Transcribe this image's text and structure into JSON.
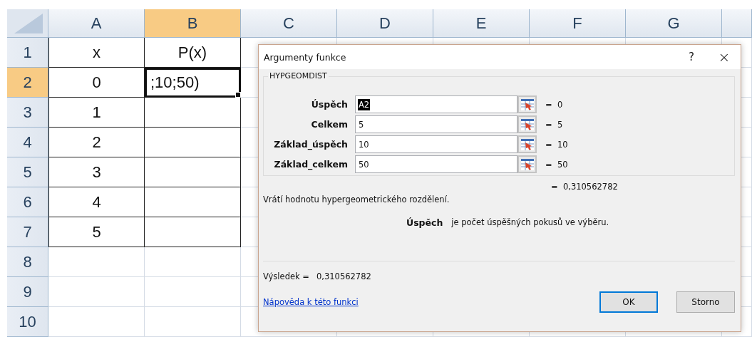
{
  "sheet": {
    "columns": [
      {
        "label": "A",
        "selected": false
      },
      {
        "label": "B",
        "selected": true
      },
      {
        "label": "C",
        "selected": false
      },
      {
        "label": "D",
        "selected": false
      },
      {
        "label": "E",
        "selected": false
      },
      {
        "label": "F",
        "selected": false
      },
      {
        "label": "G",
        "selected": false
      }
    ],
    "rows": [
      {
        "header": "1",
        "selected": false,
        "boxed": true,
        "cells": [
          {
            "text": "x",
            "active": false
          },
          {
            "text": "P(x)",
            "active": false
          }
        ]
      },
      {
        "header": "2",
        "selected": true,
        "boxed": true,
        "cells": [
          {
            "text": "0",
            "active": false
          },
          {
            "text": ";10;50)",
            "active": true
          }
        ]
      },
      {
        "header": "3",
        "selected": false,
        "boxed": true,
        "cells": [
          {
            "text": "1",
            "active": false
          }
        ]
      },
      {
        "header": "4",
        "selected": false,
        "boxed": true,
        "cells": [
          {
            "text": "2",
            "active": false
          }
        ]
      },
      {
        "header": "5",
        "selected": false,
        "boxed": true,
        "cells": [
          {
            "text": "3",
            "active": false
          }
        ]
      },
      {
        "header": "6",
        "selected": false,
        "boxed": true,
        "cells": [
          {
            "text": "4",
            "active": false
          }
        ]
      },
      {
        "header": "7",
        "selected": false,
        "boxed": true,
        "cells": [
          {
            "text": "5",
            "active": false
          }
        ]
      },
      {
        "header": "8",
        "selected": false,
        "boxed": false
      },
      {
        "header": "9",
        "selected": false,
        "boxed": false
      },
      {
        "header": "10",
        "selected": false,
        "boxed": false
      }
    ]
  },
  "dialog": {
    "title": "Argumenty funkce",
    "help_button": "?",
    "close_button": "×",
    "function_name": "HYPGEOMDIST",
    "arguments": [
      {
        "label": "Úspěch",
        "value": "A2",
        "highlighted": true,
        "result": "=  0"
      },
      {
        "label": "Celkem",
        "value": "5",
        "highlighted": false,
        "result": "=  5"
      },
      {
        "label": "Základ_úspěch",
        "value": "10",
        "highlighted": false,
        "result": "=  10"
      },
      {
        "label": "Základ_celkem",
        "value": "50",
        "highlighted": false,
        "result": "=  50"
      }
    ],
    "formula_result": "=  0,310562782",
    "description": "Vrátí hodnotu hypergeometrického rozdělení.",
    "arg_name": "Úspěch",
    "arg_help": "je počet úspěšných pokusů ve výběru.",
    "result_label": "Výsledek =",
    "result_value": "0,310562782",
    "help_link": "Nápověda k této funkci",
    "buttons": [
      {
        "label": "OK",
        "default": true
      },
      {
        "label": "Storno",
        "default": false
      }
    ]
  }
}
